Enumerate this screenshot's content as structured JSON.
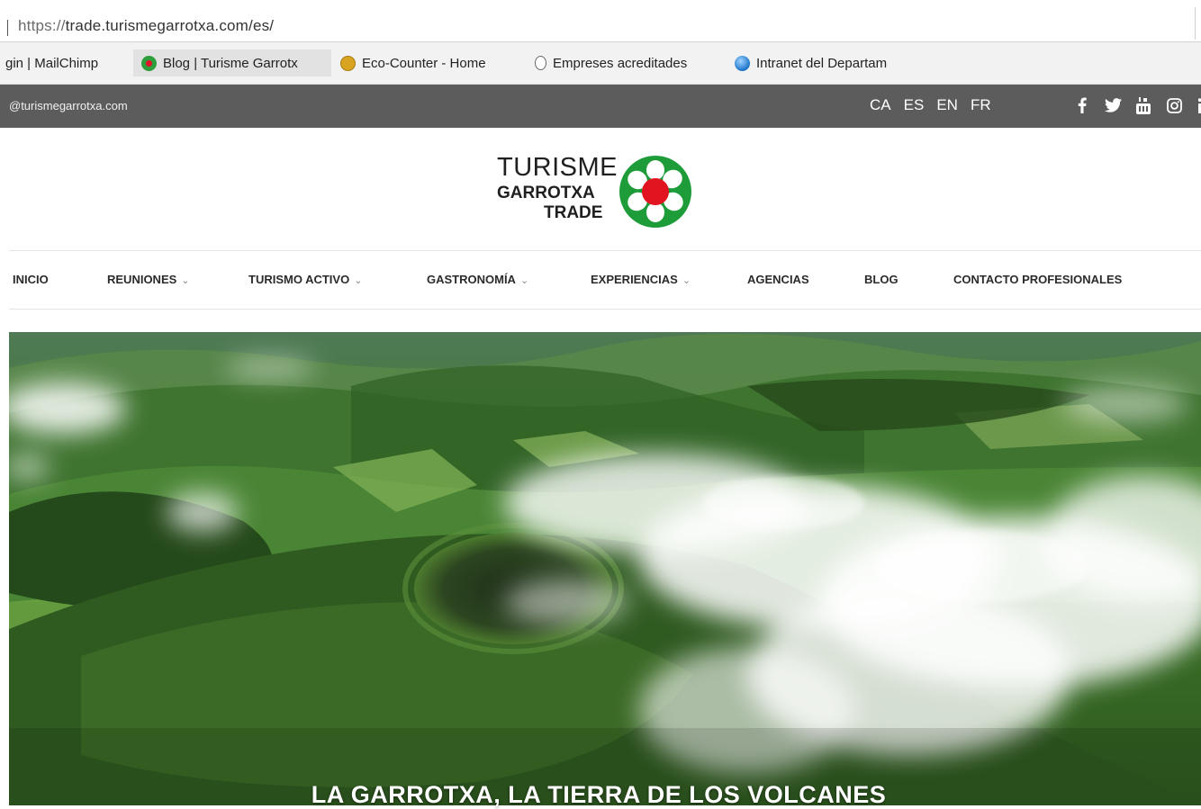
{
  "browser": {
    "url_scheme": "https://",
    "url_rest": "trade.turismegarrotxa.com/es/",
    "bookmarks": [
      {
        "label": "gin | MailChimp",
        "icon": "none"
      },
      {
        "label": "Blog | Turisme Garrotx",
        "icon": "turisme-garrotxa-flower-icon"
      },
      {
        "label": "Eco-Counter - Home",
        "icon": "eco-counter-icon"
      },
      {
        "label": "Empreses acreditades",
        "icon": "page-icon"
      },
      {
        "label": "Intranet del Departam",
        "icon": "globe-icon"
      }
    ]
  },
  "topbar": {
    "email": "@turismegarrotxa.com",
    "languages": [
      "CA",
      "ES",
      "EN",
      "FR"
    ],
    "socials": [
      "facebook-icon",
      "twitter-icon",
      "youtube-icon",
      "instagram-icon",
      "linkedin-icon"
    ]
  },
  "logo": {
    "line1": "TURISME",
    "line2": "GARROTXA",
    "line3": "TRADE",
    "colors": {
      "green": "#1e9c3a",
      "red": "#e1141f"
    }
  },
  "nav": {
    "items": [
      {
        "label": "INICIO",
        "dropdown": false
      },
      {
        "label": "REUNIONES",
        "dropdown": true
      },
      {
        "label": "TURISMO ACTIVO",
        "dropdown": true
      },
      {
        "label": "GASTRONOMÍA",
        "dropdown": true
      },
      {
        "label": "EXPERIENCIAS",
        "dropdown": true
      },
      {
        "label": "AGENCIAS",
        "dropdown": false
      },
      {
        "label": "BLOG",
        "dropdown": false
      },
      {
        "label": "CONTACTO PROFESIONALES",
        "dropdown": false
      }
    ],
    "chevron": "⌄"
  },
  "hero": {
    "title": "LA GARROTXA, LA TIERRA DE LOS VOLCANES"
  }
}
